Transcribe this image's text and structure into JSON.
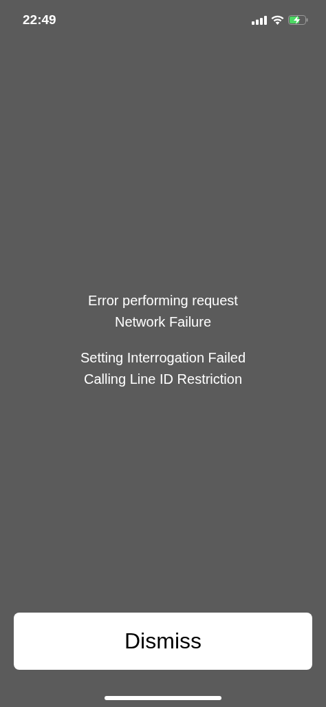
{
  "status_bar": {
    "time": "22:49"
  },
  "message_blocks": [
    {
      "lines": [
        "Error performing request",
        "Network Failure"
      ]
    },
    {
      "lines": [
        "Setting Interrogation Failed",
        "Calling Line ID Restriction"
      ]
    }
  ],
  "dismiss_button": {
    "label": "Dismiss"
  }
}
